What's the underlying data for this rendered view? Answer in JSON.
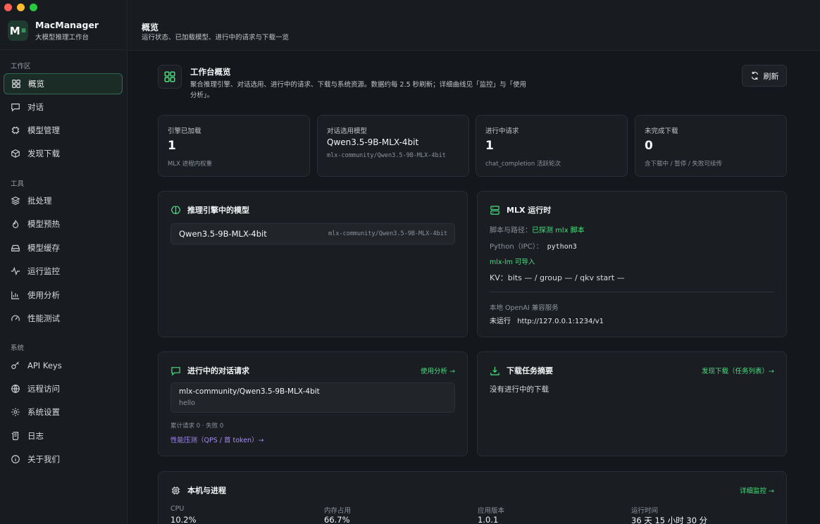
{
  "app": {
    "title": "MacManager",
    "subtitle": "大模型推理工作台",
    "logo_text": "M",
    "logo_accent": "≡"
  },
  "sidebar": {
    "sections": [
      {
        "label": "工作区"
      },
      {
        "label": "工具"
      },
      {
        "label": "系统"
      }
    ],
    "items": [
      {
        "label": "概览",
        "icon": "grid-icon",
        "active": true
      },
      {
        "label": "对话",
        "icon": "chat-icon"
      },
      {
        "label": "模型管理",
        "icon": "chip-icon"
      },
      {
        "label": "发现下载",
        "icon": "box-icon"
      },
      {
        "label": "批处理",
        "icon": "layers-icon"
      },
      {
        "label": "模型预热",
        "icon": "flame-icon"
      },
      {
        "label": "模型缓存",
        "icon": "drive-icon"
      },
      {
        "label": "运行监控",
        "icon": "pulse-icon"
      },
      {
        "label": "使用分析",
        "icon": "bar-chart-icon"
      },
      {
        "label": "性能测试",
        "icon": "gauge-icon"
      },
      {
        "label": "API Keys",
        "icon": "key-icon"
      },
      {
        "label": "远程访问",
        "icon": "globe-icon"
      },
      {
        "label": "系统设置",
        "icon": "gear-icon"
      },
      {
        "label": "日志",
        "icon": "scroll-icon"
      },
      {
        "label": "关于我们",
        "icon": "info-icon"
      }
    ]
  },
  "header": {
    "title": "概览",
    "subtitle": "运行状态、已加载模型、进行中的请求与下载一览"
  },
  "overview": {
    "title": "工作台概览",
    "description": "聚合推理引擎、对话选用、进行中的请求、下载与系统资源。数据约每 2.5 秒刷新；详细曲线见「监控」与「使用分析」。",
    "refresh_label": "刷新"
  },
  "stats": [
    {
      "label": "引擎已加载",
      "value": "1",
      "note": "MLX 进程内权重"
    },
    {
      "label": "对话选用模型",
      "value": "Qwen3.5-9B-MLX-4bit",
      "note": "mlx-community/Qwen3.5-9B-MLX-4bit"
    },
    {
      "label": "进行中请求",
      "value": "1",
      "note": "chat_completion 活跃轮次"
    },
    {
      "label": "未完成下载",
      "value": "0",
      "note": "含下载中 / 暂停 / 失败可续传"
    }
  ],
  "engine_models": {
    "title": "推理引擎中的模型",
    "rows": [
      {
        "name": "Qwen3.5-9B-MLX-4bit",
        "repo": "mlx-community/Qwen3.5-9B-MLX-4bit"
      }
    ]
  },
  "runtime": {
    "title": "MLX 运行时",
    "script_label": "脚本与路径：",
    "script_value": "已探测 mlx 脚本",
    "python_label": "Python（IPC）：",
    "python_value": "python3",
    "mlx_lm_status": "mlx-lm 可导入",
    "kv_line": "KV：bits — / group — / qkv start —",
    "service_label": "本地 OpenAI 兼容服务",
    "service_status": "未运行",
    "service_url": "http://127.0.0.1:1234/v1"
  },
  "chat_requests": {
    "title": "进行中的对话请求",
    "link": "使用分析 →",
    "rows": [
      {
        "model": "mlx-community/Qwen3.5-9B-MLX-4bit",
        "preview": "hello"
      }
    ],
    "summary": "累计请求 0 · 失败 0",
    "bench_link": "性能压测（QPS / 首 token）→"
  },
  "downloads": {
    "title": "下载任务摘要",
    "link": "发现下载（任务列表）→",
    "empty": "没有进行中的下载"
  },
  "machine": {
    "title": "本机与进程",
    "link": "详细监控 →",
    "metrics": [
      {
        "label": "CPU",
        "value": "10.2%"
      },
      {
        "label": "内存占用",
        "value": "66.7%"
      },
      {
        "label": "应用版本",
        "value": "1.0.1"
      },
      {
        "label": "运行时间",
        "value": "36 天 15 小时 30 分"
      }
    ]
  },
  "colors": {
    "accent": "#4ade80",
    "link_purple": "#a78bfa",
    "background": "#14171b",
    "card": "#1a1d21"
  }
}
